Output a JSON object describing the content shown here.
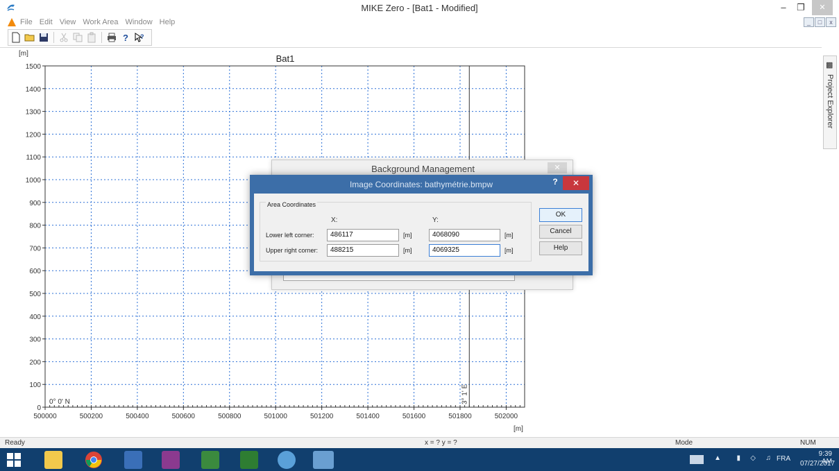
{
  "window": {
    "title": "MIKE Zero - [Bat1 - Modified]",
    "minimize": "–",
    "restore": "❐",
    "close": "✕"
  },
  "menu": {
    "items": [
      "File",
      "Edit",
      "View",
      "Work Area",
      "Window",
      "Help"
    ],
    "mdi": [
      "_",
      "□",
      "x"
    ]
  },
  "toolbar": {
    "icons": [
      "new-file-icon",
      "open-folder-icon",
      "save-icon",
      "cut-icon",
      "copy-icon",
      "paste-icon",
      "print-icon",
      "help-icon",
      "context-help-icon"
    ]
  },
  "project_explorer": {
    "label": "Project Explorer"
  },
  "chart_data": {
    "type": "line",
    "title": "Bat1",
    "xlabel": "[m]",
    "ylabel": "[m]",
    "xlim": [
      500000,
      502080
    ],
    "ylim": [
      0,
      1500
    ],
    "x_ticks": [
      500000,
      500200,
      500400,
      500600,
      500800,
      501000,
      501200,
      501400,
      501600,
      501800,
      502000
    ],
    "y_ticks": [
      0,
      100,
      200,
      300,
      400,
      500,
      600,
      700,
      800,
      900,
      1000,
      1100,
      1200,
      1300,
      1400,
      1500
    ],
    "grid": true,
    "grid_style": "dotted",
    "grid_color": "#2a6fd6",
    "meridian_x": 501840,
    "meridian_label": "3° 1' E",
    "parallel_label": "0° 0' N"
  },
  "bg_dialog": {
    "title": "Background Management",
    "close": "✕"
  },
  "img_dialog": {
    "title": "Image Coordinates: bathymétrie.bmpw",
    "help": "?",
    "close": "✕",
    "group_label": "Area Coordinates",
    "x_label": "X:",
    "y_label": "Y:",
    "lower_left_label": "Lower left corner:",
    "upper_right_label": "Upper right corner:",
    "lower_left_x": "486117",
    "lower_left_y": "4068090",
    "upper_right_x": "488215",
    "upper_right_y": "4069325",
    "unit": "[m]",
    "ok": "OK",
    "cancel": "Cancel",
    "help_button": "Help"
  },
  "status": {
    "ready": "Ready",
    "coords": "x = ? y = ?",
    "mode": "Mode",
    "num": "NUM"
  },
  "taskbar": {
    "lang": "FRA",
    "time": "9:39 AM",
    "date": "07/27/2017"
  }
}
